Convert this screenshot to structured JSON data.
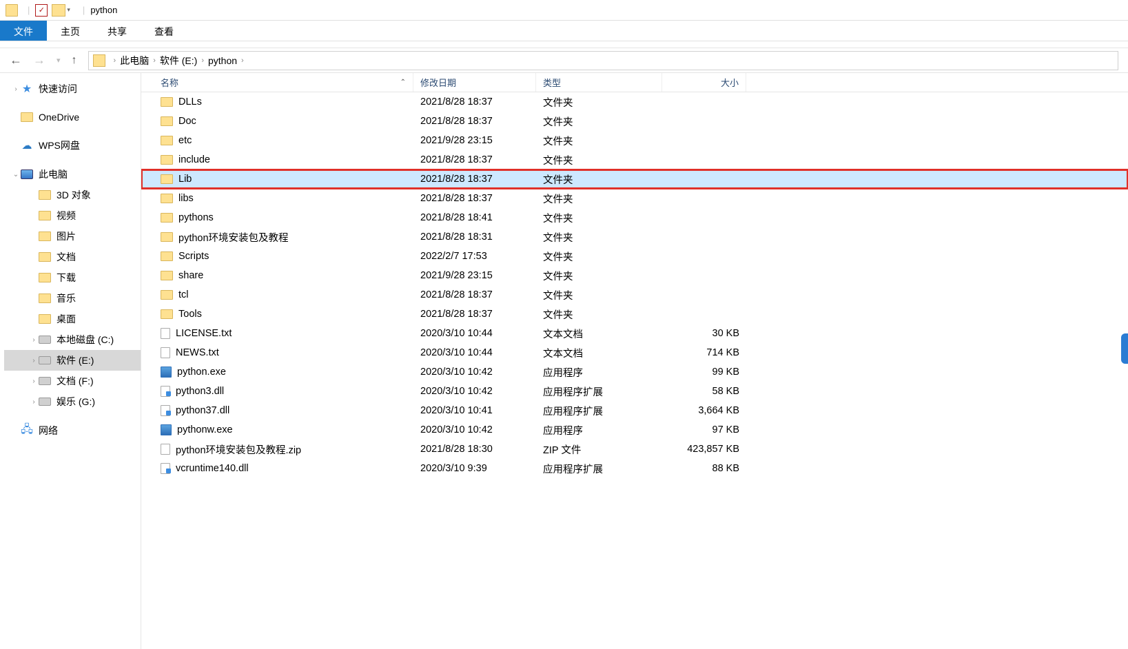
{
  "titlebar": {
    "text": "python"
  },
  "ribbon": {
    "file": "文件",
    "home": "主页",
    "share": "共享",
    "view": "查看"
  },
  "breadcrumbs": [
    "此电脑",
    "软件 (E:)",
    "python"
  ],
  "tree": {
    "quick_access": "快速访问",
    "onedrive": "OneDrive",
    "wps": "WPS网盘",
    "this_pc": "此电脑",
    "items": [
      "3D 对象",
      "视频",
      "图片",
      "文档",
      "下载",
      "音乐",
      "桌面",
      "本地磁盘 (C:)",
      "软件 (E:)",
      "文档 (F:)",
      "娱乐 (G:)"
    ],
    "selected_index": 8,
    "network": "网络"
  },
  "columns": {
    "name": "名称",
    "date": "修改日期",
    "type": "类型",
    "size": "大小"
  },
  "files": [
    {
      "name": "DLLs",
      "date": "2021/8/28 18:37",
      "type": "文件夹",
      "size": "",
      "icon": "folder"
    },
    {
      "name": "Doc",
      "date": "2021/8/28 18:37",
      "type": "文件夹",
      "size": "",
      "icon": "folder"
    },
    {
      "name": "etc",
      "date": "2021/9/28 23:15",
      "type": "文件夹",
      "size": "",
      "icon": "folder"
    },
    {
      "name": "include",
      "date": "2021/8/28 18:37",
      "type": "文件夹",
      "size": "",
      "icon": "folder"
    },
    {
      "name": "Lib",
      "date": "2021/8/28 18:37",
      "type": "文件夹",
      "size": "",
      "icon": "folder",
      "selected": true,
      "highlight": true
    },
    {
      "name": "libs",
      "date": "2021/8/28 18:37",
      "type": "文件夹",
      "size": "",
      "icon": "folder"
    },
    {
      "name": "pythons",
      "date": "2021/8/28 18:41",
      "type": "文件夹",
      "size": "",
      "icon": "folder"
    },
    {
      "name": "python环境安装包及教程",
      "date": "2021/8/28 18:31",
      "type": "文件夹",
      "size": "",
      "icon": "folder"
    },
    {
      "name": "Scripts",
      "date": "2022/2/7 17:53",
      "type": "文件夹",
      "size": "",
      "icon": "folder"
    },
    {
      "name": "share",
      "date": "2021/9/28 23:15",
      "type": "文件夹",
      "size": "",
      "icon": "folder"
    },
    {
      "name": "tcl",
      "date": "2021/8/28 18:37",
      "type": "文件夹",
      "size": "",
      "icon": "folder"
    },
    {
      "name": "Tools",
      "date": "2021/8/28 18:37",
      "type": "文件夹",
      "size": "",
      "icon": "folder"
    },
    {
      "name": "LICENSE.txt",
      "date": "2020/3/10 10:44",
      "type": "文本文档",
      "size": "30 KB",
      "icon": "txt"
    },
    {
      "name": "NEWS.txt",
      "date": "2020/3/10 10:44",
      "type": "文本文档",
      "size": "714 KB",
      "icon": "txt"
    },
    {
      "name": "python.exe",
      "date": "2020/3/10 10:42",
      "type": "应用程序",
      "size": "99 KB",
      "icon": "exe"
    },
    {
      "name": "python3.dll",
      "date": "2020/3/10 10:42",
      "type": "应用程序扩展",
      "size": "58 KB",
      "icon": "dll"
    },
    {
      "name": "python37.dll",
      "date": "2020/3/10 10:41",
      "type": "应用程序扩展",
      "size": "3,664 KB",
      "icon": "dll"
    },
    {
      "name": "pythonw.exe",
      "date": "2020/3/10 10:42",
      "type": "应用程序",
      "size": "97 KB",
      "icon": "exe"
    },
    {
      "name": "python环境安装包及教程.zip",
      "date": "2021/8/28 18:30",
      "type": "ZIP 文件",
      "size": "423,857 KB",
      "icon": "zip"
    },
    {
      "name": "vcruntime140.dll",
      "date": "2020/3/10 9:39",
      "type": "应用程序扩展",
      "size": "88 KB",
      "icon": "dll"
    }
  ]
}
